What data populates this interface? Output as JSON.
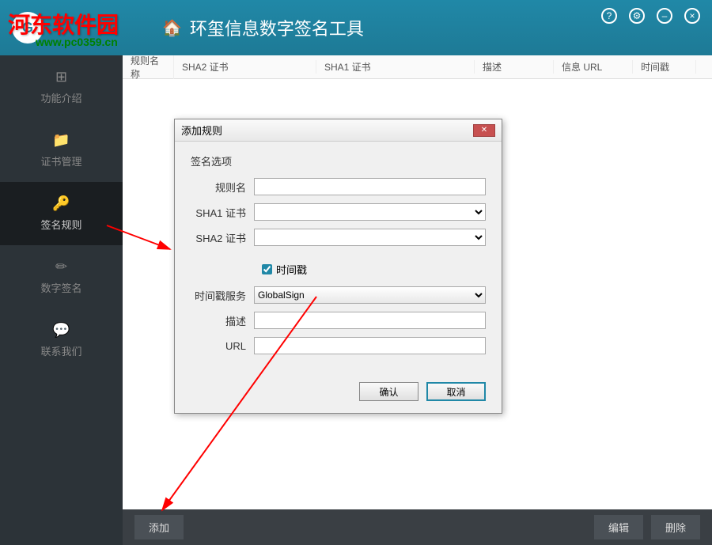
{
  "app": {
    "title": "环玺信息数字签名工具",
    "watermark": "河东软件园",
    "watermark_url": "www.pc0359.cn"
  },
  "titlebar": {
    "help": "?",
    "settings": "⚙",
    "minimize": "–",
    "close": "×"
  },
  "sidebar": {
    "items": [
      {
        "icon": "⊞",
        "label": "功能介绍"
      },
      {
        "icon": "📁",
        "label": "证书管理"
      },
      {
        "icon": "🔑",
        "label": "签名规则"
      },
      {
        "icon": "✏",
        "label": "数字签名"
      },
      {
        "icon": "💬",
        "label": "联系我们"
      }
    ]
  },
  "table": {
    "headers": {
      "name": "规则名称",
      "sha2": "SHA2 证书",
      "sha1": "SHA1 证书",
      "desc": "描述",
      "url": "信息 URL",
      "timestamp": "时间戳"
    }
  },
  "bottomBar": {
    "add": "添加",
    "edit": "编辑",
    "delete": "删除"
  },
  "dialog": {
    "title": "添加规则",
    "section": "签名选项",
    "labels": {
      "ruleName": "规则名",
      "sha1": "SHA1 证书",
      "sha2": "SHA2 证书",
      "timestamp": "时间戳",
      "timestampService": "时间戳服务",
      "desc": "描述",
      "url": "URL"
    },
    "values": {
      "ruleName": "",
      "sha1": "",
      "sha2": "",
      "timestampChecked": true,
      "timestampService": "GlobalSign",
      "desc": "",
      "url": ""
    },
    "buttons": {
      "ok": "确认",
      "cancel": "取消"
    }
  }
}
